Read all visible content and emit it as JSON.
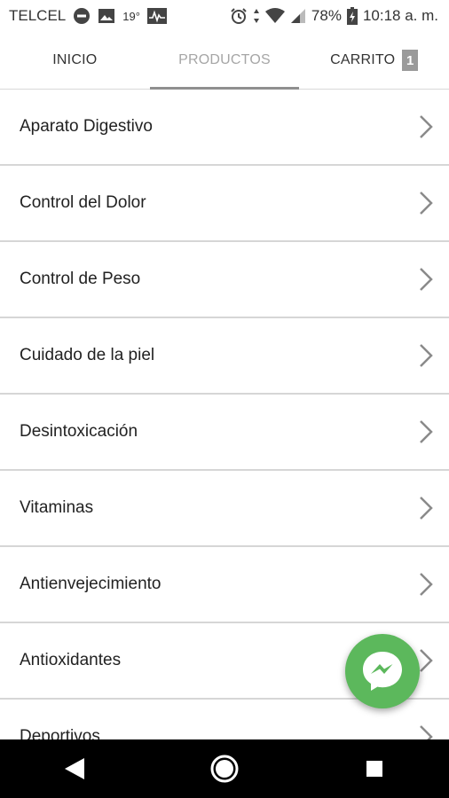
{
  "status_bar": {
    "carrier": "TELCEL",
    "temperature": "19°",
    "battery": "78%",
    "time": "10:18 a. m.",
    "icons": [
      "dnd-icon",
      "image-icon",
      "activity-icon",
      "alarm-icon",
      "data-arrows-icon",
      "wifi-icon",
      "signal-icon",
      "battery-icon"
    ]
  },
  "tabs": [
    {
      "label": "INICIO",
      "active": false
    },
    {
      "label": "PRODUCTOS",
      "active": true
    },
    {
      "label": "CARRITO",
      "active": false,
      "badge": "1"
    }
  ],
  "categories": [
    "Aparato Digestivo",
    "Control del Dolor",
    "Control de Peso",
    "Cuidado de la piel",
    "Desintoxicación",
    "Vitaminas",
    "Antienvejecimiento",
    "Antioxidantes",
    "Deportivos"
  ],
  "fab": {
    "icon": "messenger-icon",
    "color": "#5cb85c"
  },
  "nav": {
    "icons": [
      "back-icon",
      "home-icon",
      "recents-icon"
    ]
  }
}
